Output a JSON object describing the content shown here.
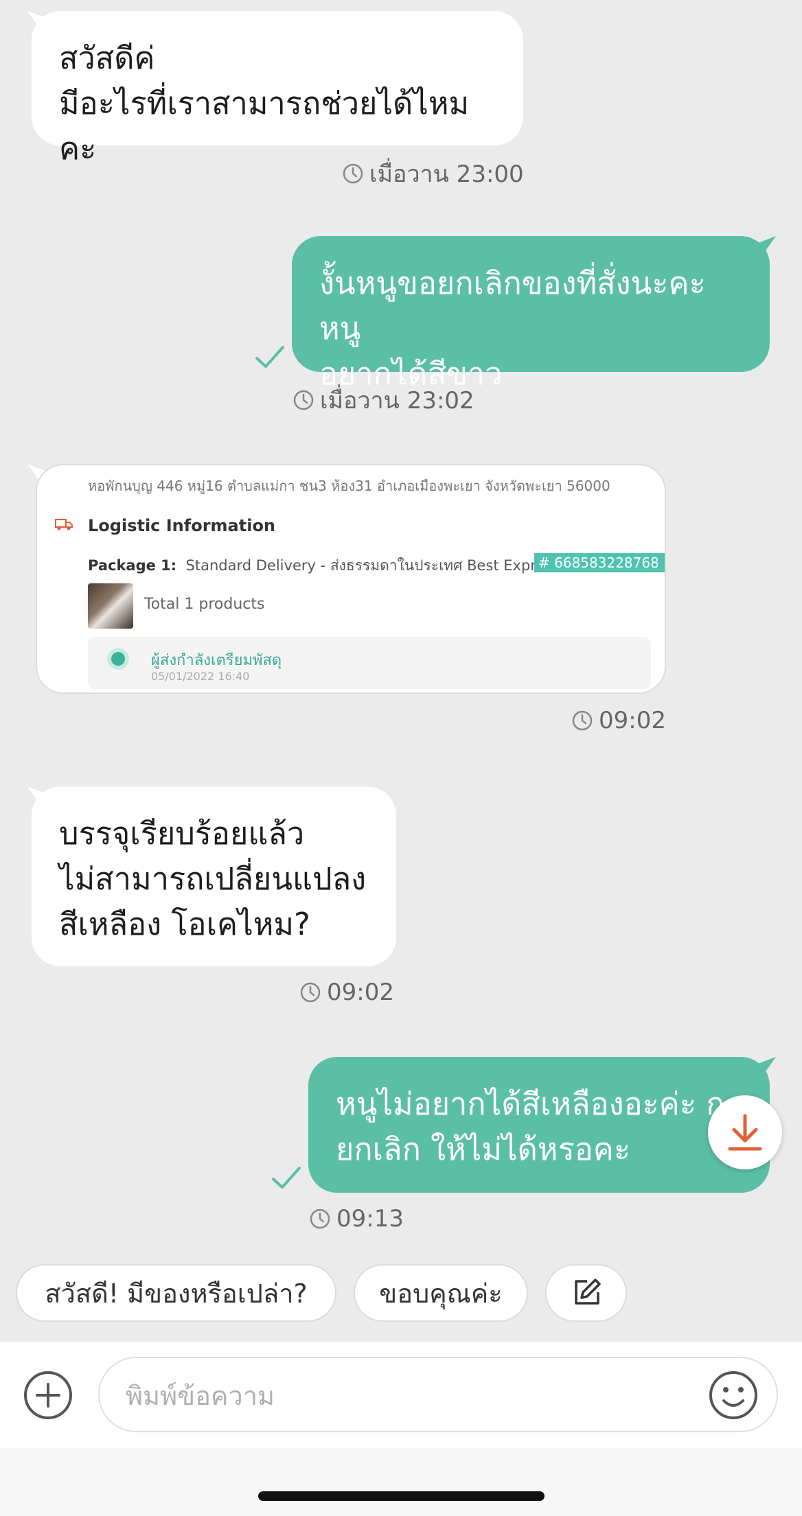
{
  "messages": {
    "m1": {
      "line1": "สวัสดีค่",
      "line2": "มีอะไรที่เราสามารถช่วยได้ไหมคะ",
      "time": "เมื่อวาน 23:00"
    },
    "m2": {
      "line1": "งั้นหนูขอยกเลิกของที่สั่งนะคะหนู",
      "line2": "อยากได้สีขาว",
      "time": "เมื่อวาน 23:02"
    },
    "m3": {
      "address": "หอพักนบุญ 446 หมู่16 ตำบลแม่กา ชน3 ห้อง31 อำเภอเมืองพะเยา จังหวัดพะเยา 56000",
      "logistic_title": "Logistic Information",
      "package_label": "Package 1:",
      "package_info": "Standard Delivery - ส่งธรรมดาในประเทศ   Best Express",
      "tracking": "# 668583228768",
      "total": "Total 1 products",
      "status": "ผู้ส่งกำลังเตรียมพัสดุ",
      "status_date": "05/01/2022 16:40",
      "time": "09:02"
    },
    "m4": {
      "line1": "บรรจุเรียบร้อยแล้ว",
      "line2": "ไม่สามารถเปลี่ยนแปลง",
      "line3": "สีเหลือง โอเคไหม?",
      "time": "09:02"
    },
    "m5": {
      "line1": "หนูไม่อยากได้สีเหลืองอะค่ะ ก",
      "line2": "ยกเลิก ให้ไม่ได้หรอคะ",
      "time": "09:13"
    }
  },
  "quick_replies": [
    "สวัสดี! มีของหรือเปล่า?",
    "ขอบคุณค่ะ"
  ],
  "input": {
    "placeholder": "พิมพ์ข้อความ"
  },
  "icons": {
    "clock": "clock-icon",
    "check": "check-icon",
    "download": "arrow-down-icon",
    "edit": "edit-icon",
    "plus": "plus-icon",
    "emoji": "smiley-icon",
    "truck": "truck-icon"
  },
  "colors": {
    "accent": "#5bbfa6",
    "background": "#ebebeb",
    "download_arrow": "#e0603a"
  }
}
